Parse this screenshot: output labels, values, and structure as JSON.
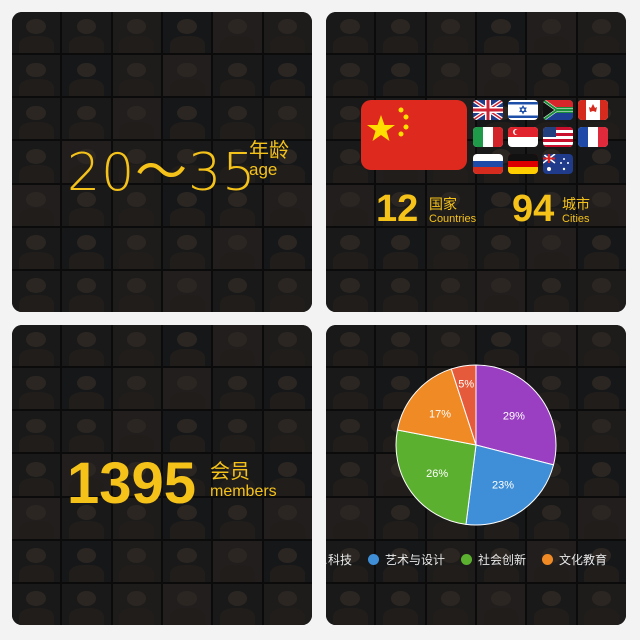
{
  "panels": {
    "age": {
      "range": "20～35",
      "label_cn": "年龄",
      "label_en": "age"
    },
    "countries": {
      "count": "12",
      "count_cn": "国家",
      "count_en": "Countries",
      "cities": "94",
      "cities_cn": "城市",
      "cities_en": "Cities",
      "flags": [
        "uk-flag",
        "israel-flag",
        "south-africa-flag",
        "canada-flag",
        "italy-flag",
        "singapore-flag",
        "usa-flag",
        "france-flag",
        "russia-flag",
        "germany-flag",
        "australia-flag"
      ]
    },
    "members": {
      "count": "1395",
      "label_cn": "会员",
      "label_en": "members"
    }
  },
  "chart_data": {
    "type": "pie",
    "slices": [
      {
        "label": "",
        "value": 29,
        "display": "29%",
        "color": "#9b3fc2"
      },
      {
        "label": "艺术与设计",
        "value": 23,
        "display": "23%",
        "color": "#3f8fd8"
      },
      {
        "label": "社会创新",
        "value": 26,
        "display": "26%",
        "color": "#5cb030"
      },
      {
        "label": "文化教育",
        "value": 17,
        "display": "17%",
        "color": "#f08a24"
      },
      {
        "label": "",
        "value": 5,
        "display": "5%",
        "color": "#e65a3c"
      }
    ],
    "legend": [
      {
        "label": "…科技",
        "color": "#9b3fc2",
        "text": "…科技"
      },
      {
        "label": "艺术与设计",
        "color": "#3f8fd8",
        "text": "艺术与设计"
      },
      {
        "label": "社会创新",
        "color": "#5cb030",
        "text": "社会创新"
      },
      {
        "label": "文化教育",
        "color": "#f08a24",
        "text": "文化教育"
      }
    ],
    "legend_placement": "bottom"
  }
}
